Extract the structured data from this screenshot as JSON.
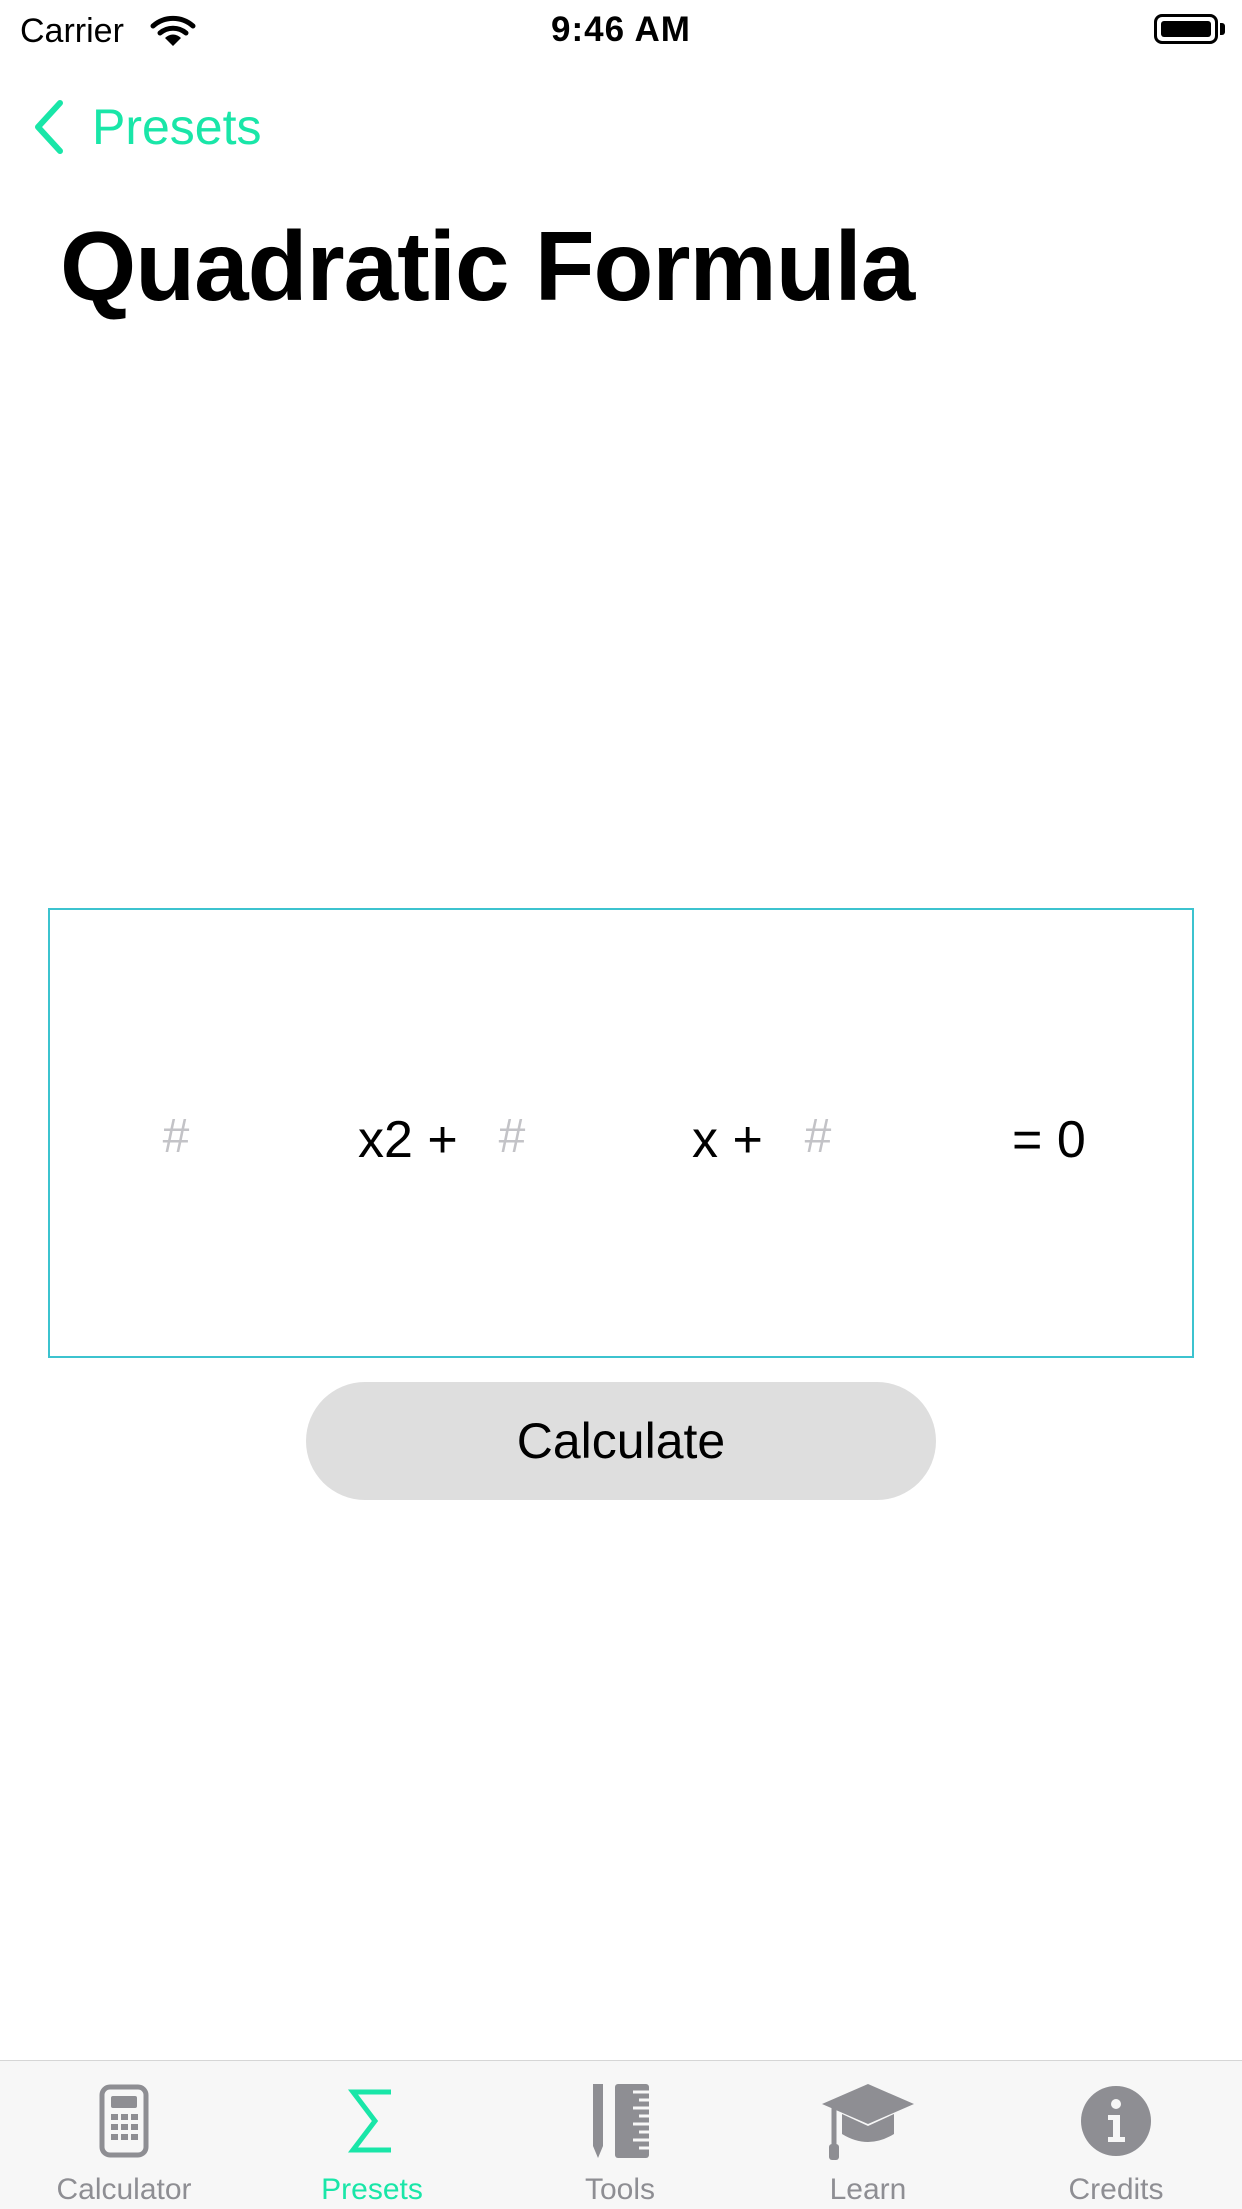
{
  "status_bar": {
    "carrier": "Carrier",
    "time": "9:46 AM"
  },
  "nav": {
    "back_label": "Presets",
    "title": "Quadratic Formula"
  },
  "equation": {
    "a_placeholder": "#",
    "a_value": "",
    "term_x2": "x2 +",
    "b_placeholder": "#",
    "b_value": "",
    "term_x": "x +",
    "c_placeholder": "#",
    "c_value": "",
    "equals": "= 0"
  },
  "calculate_label": "Calculate",
  "tabs": [
    {
      "label": "Calculator",
      "icon": "calculator-icon",
      "active": false
    },
    {
      "label": "Presets",
      "icon": "sigma-icon",
      "active": true
    },
    {
      "label": "Tools",
      "icon": "pencil-ruler-icon",
      "active": false
    },
    {
      "label": "Learn",
      "icon": "graduation-cap-icon",
      "active": false
    },
    {
      "label": "Credits",
      "icon": "info-icon",
      "active": false
    }
  ],
  "colors": {
    "accent": "#19e6a8",
    "box_border": "#3cc3cf",
    "tab_inactive": "#8e8e93",
    "button_bg": "#dedede"
  }
}
